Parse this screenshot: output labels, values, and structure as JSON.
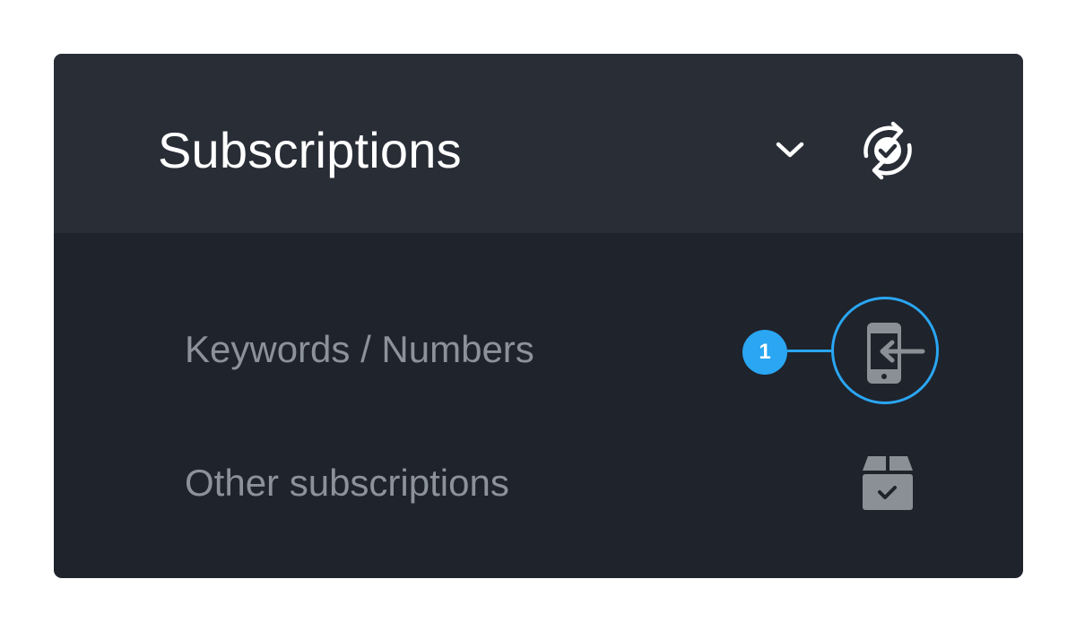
{
  "panel": {
    "title": "Subscriptions",
    "header_icons": [
      "chevron-down-icon",
      "sync-check-icon"
    ]
  },
  "menu": {
    "items": [
      {
        "label": "Keywords / Numbers",
        "icon": "phone-arrow-in-icon"
      },
      {
        "label": "Other subscriptions",
        "icon": "package-check-icon"
      }
    ]
  },
  "callout": {
    "number": "1",
    "color": "#2aa6f3"
  },
  "colors": {
    "header_bg": "#292d36",
    "body_bg": "#1f232c",
    "title_text": "#ffffff",
    "label_text": "#8b929b",
    "icon_gray": "#8b9096"
  }
}
